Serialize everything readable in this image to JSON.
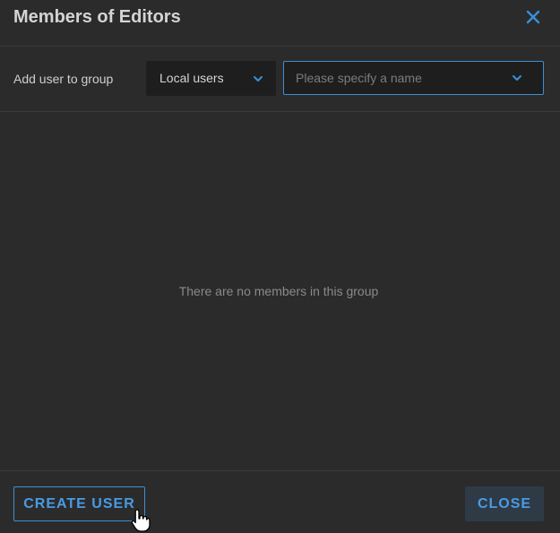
{
  "dialog": {
    "title": "Members of Editors",
    "close_icon": "close-icon",
    "accent_color": "#3b8fd6"
  },
  "add_user": {
    "label": "Add user to group",
    "source_select": {
      "selected": "Local users",
      "icon": "chevron-down-icon"
    },
    "name_input": {
      "value": "",
      "placeholder": "Please specify a name",
      "icon": "chevron-down-icon"
    }
  },
  "members": {
    "empty_message": "There are no members in this group"
  },
  "footer": {
    "create_label": "CREATE USER",
    "close_label": "CLOSE"
  }
}
